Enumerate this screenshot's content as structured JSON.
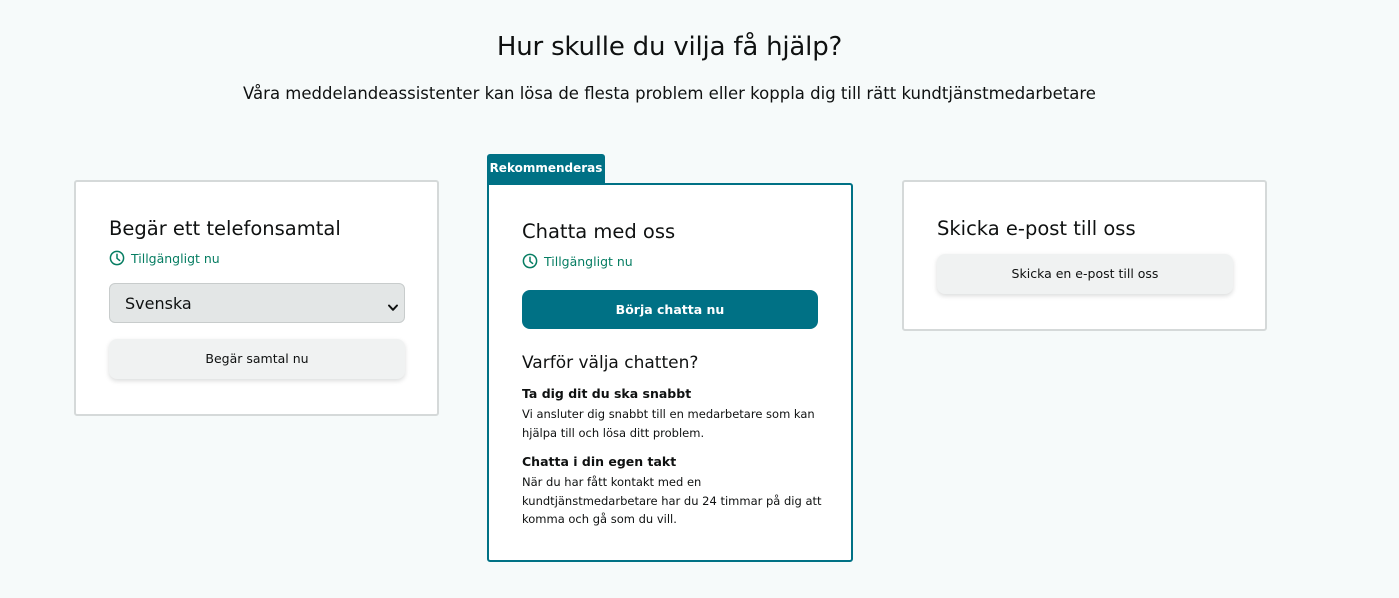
{
  "header": {
    "title": "Hur skulle du vilja få hjälp?",
    "subtitle": "Våra meddelandeassistenter kan lösa de flesta problem eller koppla dig till rätt kundtjänstmedarbetare"
  },
  "phone_card": {
    "title": "Begär ett telefonsamtal",
    "availability": "Tillgängligt nu",
    "language_select": {
      "value": "Svenska"
    },
    "button_label": "Begär samtal nu"
  },
  "chat_card": {
    "badge": "Rekommenderas",
    "title": "Chatta med oss",
    "availability": "Tillgängligt nu",
    "button_label": "Börja chatta nu",
    "why_title": "Varför välja chatten?",
    "reasons": [
      {
        "title": "Ta dig dit du ska snabbt",
        "text": "Vi ansluter dig snabbt till en medarbetare som kan hjälpa till och lösa ditt problem."
      },
      {
        "title": "Chatta i din egen takt",
        "text": "När du har fått kontakt med en kundtjänstmedarbetare har du 24 timmar på dig att komma och gå som du vill."
      }
    ]
  },
  "email_card": {
    "title": "Skicka e-post till oss",
    "button_label": "Skicka en e-post till oss"
  },
  "icons": {
    "availability": "clock-icon",
    "select": "chevron-down-icon"
  },
  "colors": {
    "accent": "#007185",
    "available": "#067d62",
    "background": "#f6fafa",
    "secondary_button": "#f0f2f2"
  }
}
